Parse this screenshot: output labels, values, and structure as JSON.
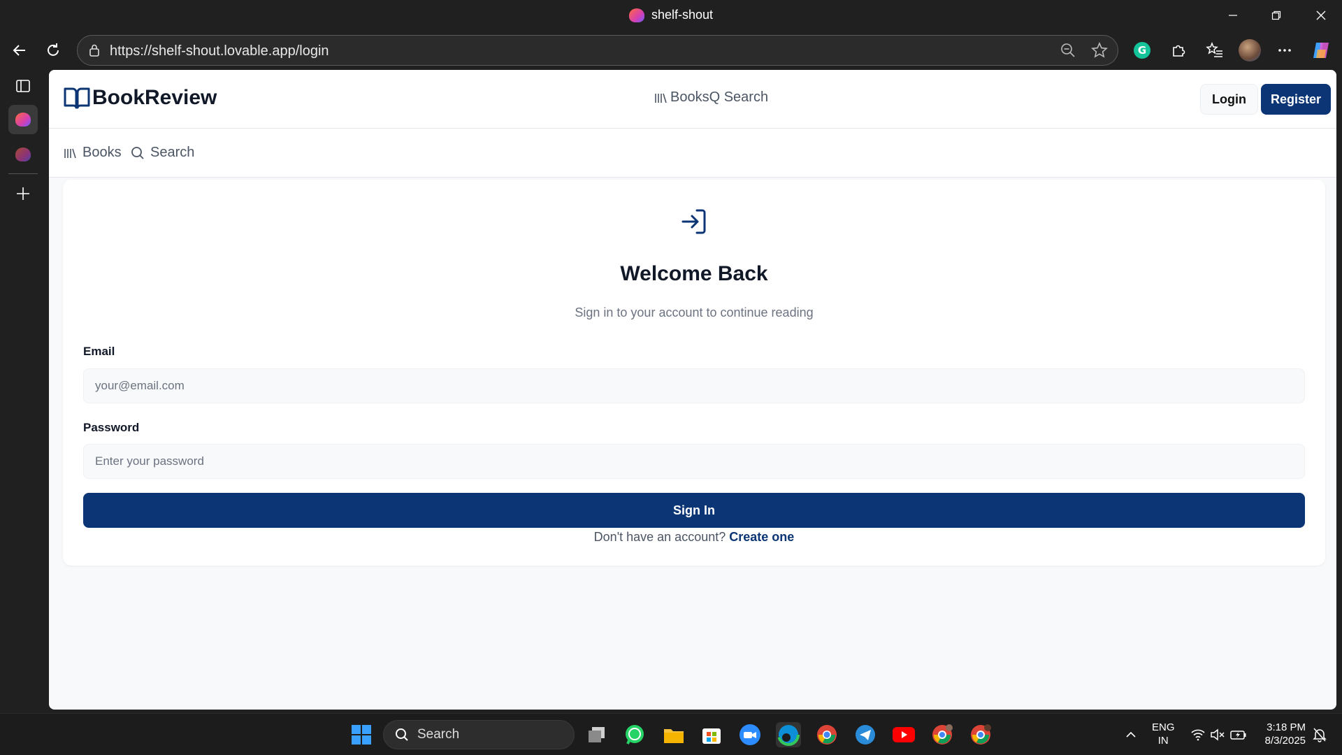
{
  "browser": {
    "tab_title": "shelf-shout",
    "url": "https://shelf-shout.lovable.app/login"
  },
  "app": {
    "brand": "BookReview",
    "topnav": {
      "books": "BooksQ Search"
    },
    "header_buttons": {
      "login": "Login",
      "register": "Register"
    },
    "subnav": {
      "books": "Books",
      "search": "Search"
    }
  },
  "login_card": {
    "title": "Welcome Back",
    "subtitle": "Sign in to your account to continue reading",
    "email_label": "Email",
    "email_placeholder": "your@email.com",
    "password_label": "Password",
    "password_placeholder": "Enter your password",
    "submit_label": "Sign In",
    "footer_text": "Don't have an account?",
    "footer_link": "Create one"
  },
  "taskbar": {
    "search_label": "Search",
    "lang_line1": "ENG",
    "lang_line2": "IN",
    "time": "3:18 PM",
    "date": "8/3/2025"
  },
  "colors": {
    "primary": "#0b3575",
    "page_bg": "#f8f9fa"
  }
}
